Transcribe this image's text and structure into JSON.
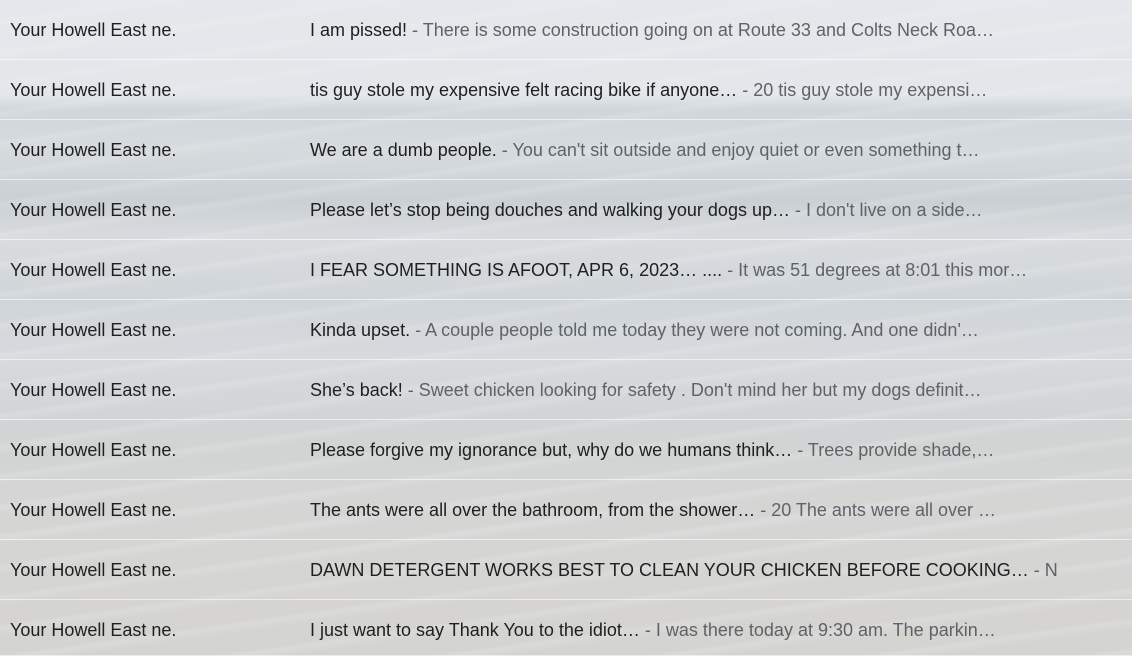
{
  "rows": [
    {
      "sender": "Your Howell East ne.",
      "subject": "I am pissed!",
      "snippet": " - There is some construction going on at Route 33 and Colts Neck Roa…"
    },
    {
      "sender": "Your Howell East ne.",
      "subject": "tis guy stole my expensive felt racing bike if anyone…",
      "snippet": " - 20 tis guy stole my expensi…"
    },
    {
      "sender": "Your Howell East ne.",
      "subject": "We are a dumb people.",
      "snippet": " - You can't sit outside and enjoy quiet or even something t…"
    },
    {
      "sender": "Your Howell East ne.",
      "subject": "Please let’s stop being douches and walking your dogs up…",
      "snippet": " - I don't live on a side…"
    },
    {
      "sender": "Your Howell East ne.",
      "subject": "I FEAR SOMETHING IS AFOOT, APR 6, 2023… ....",
      "snippet": " - It was 51 degrees at 8:01 this mor…"
    },
    {
      "sender": "Your Howell East ne.",
      "subject": "Kinda upset.",
      "snippet": " - A couple people told me today they were not coming. And one didn'…"
    },
    {
      "sender": "Your Howell East ne.",
      "subject": "She’s back!",
      "snippet": " - Sweet chicken looking for safety . Don't mind her but my dogs definit…"
    },
    {
      "sender": "Your Howell East ne.",
      "subject": "Please forgive my ignorance but, why do we humans think…",
      "snippet": " - Trees provide shade,…"
    },
    {
      "sender": "Your Howell East ne.",
      "subject": "The ants were all over the bathroom, from the shower…",
      "snippet": " - 20 The ants were all over …"
    },
    {
      "sender": "Your Howell East ne.",
      "subject": "DAWN DETERGENT WORKS BEST TO CLEAN YOUR CHICKEN BEFORE COOKING…",
      "snippet": " - N"
    },
    {
      "sender": "Your Howell East ne.",
      "subject": "I just want to say Thank You to the idiot…",
      "snippet": " - I was there today at 9:30 am. The parkin…"
    }
  ]
}
